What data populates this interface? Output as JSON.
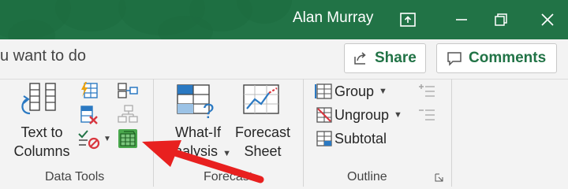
{
  "window": {
    "user_name": "Alan Murray",
    "controls": [
      "ribbon-display-options",
      "restore-down",
      "close"
    ]
  },
  "tell_me": {
    "text": "u want to do"
  },
  "share": {
    "label": "Share",
    "icon": "share-icon"
  },
  "comments": {
    "label": "Comments",
    "icon": "comment-icon"
  },
  "ribbon": {
    "data_tools": {
      "label": "Data Tools",
      "text_to_columns": {
        "line1": "Text to",
        "line2": "Columns"
      }
    },
    "forecast": {
      "label": "Forecast",
      "what_if": {
        "line1": "What-If",
        "line2": "Analysis"
      },
      "forecast_sheet": {
        "line1": "Forecast",
        "line2": "Sheet"
      }
    },
    "outline": {
      "label": "Outline",
      "group": "Group",
      "ungroup": "Ungroup",
      "subtotal": "Subtotal"
    }
  },
  "colors": {
    "brand": "#217346",
    "arrow": "#e8201f",
    "icon_blue": "#2b79c2",
    "icon_red": "#d9363e"
  }
}
